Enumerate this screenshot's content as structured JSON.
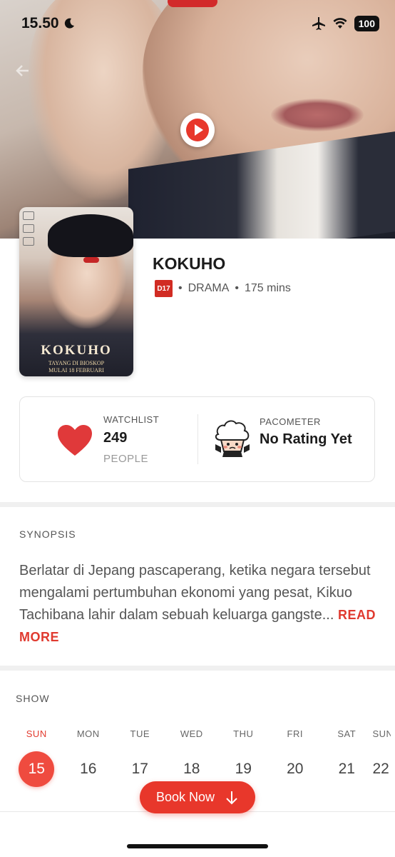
{
  "status_bar": {
    "time": "15.50",
    "battery": "100"
  },
  "movie": {
    "title": "KOKUHO",
    "rating": "D17",
    "genre": "DRAMA",
    "duration": "175 mins",
    "poster": {
      "title": "KOKUHO",
      "subtitle_line1": "TAYANG DI BIOSKOP",
      "subtitle_line2": "MULAI 18 FEBRUARI"
    }
  },
  "stats": {
    "watchlist_label": "WATCHLIST",
    "watchlist_count": "249",
    "watchlist_unit": "PEOPLE",
    "pacometer_label": "PACOMETER",
    "pacometer_value": "No Rating Yet"
  },
  "synopsis": {
    "label": "SYNOPSIS",
    "text": "Berlatar di Jepang pascaperang, ketika negara tersebut mengalami pertumbuhan ekonomi yang pesat, Kikuo Tachibana lahir dalam sebuah keluarga gangste...",
    "read_more": "READ MORE"
  },
  "show": {
    "label": "SHOW",
    "days": [
      {
        "name": "SUN",
        "num": "15",
        "active": true
      },
      {
        "name": "MON",
        "num": "16",
        "active": false
      },
      {
        "name": "TUE",
        "num": "17",
        "active": false
      },
      {
        "name": "WED",
        "num": "18",
        "active": false
      },
      {
        "name": "THU",
        "num": "19",
        "active": false
      },
      {
        "name": "FRI",
        "num": "20",
        "active": false
      },
      {
        "name": "SAT",
        "num": "21",
        "active": false
      },
      {
        "name": "SUN",
        "num": "22",
        "active": false
      }
    ]
  },
  "book_button": "Book Now",
  "colors": {
    "accent": "#e8372b",
    "rating_badge": "#d12c23",
    "heart": "#e0393a"
  }
}
